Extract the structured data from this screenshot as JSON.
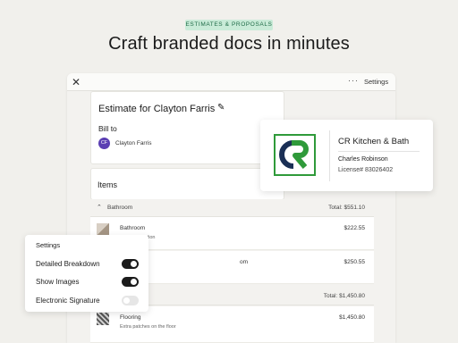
{
  "badge": "ESTIMATES & PROPOSALS",
  "headline": "Craft branded docs in minutes",
  "appbar": {
    "close_icon": "close-icon",
    "more_icon": "more-dots-icon",
    "settings_label": "Settings"
  },
  "estimate": {
    "title": "Estimate for Clayton Farris",
    "edit_icon": "pencil-icon",
    "bill_to_label": "Bill to",
    "client_initials": "CF",
    "client_name": "Clayton Farris"
  },
  "items": {
    "label": "Items",
    "groups": [
      {
        "name": "Bathroom",
        "total": "Total: $551.10"
      },
      {
        "name": "",
        "total": "Total: $1,450.80"
      }
    ],
    "line_items": [
      {
        "name": "Bathroom",
        "description": "binet installation",
        "price": "$222.55"
      },
      {
        "name": "om",
        "description": "",
        "price": "$250.55"
      },
      {
        "name": "Flooring",
        "description": "Extra patches on the floor",
        "price": "$1,450.80"
      }
    ]
  },
  "company": {
    "logo_letters": "CR",
    "name": "CR Kitchen & Bath",
    "person": "Charles Robinson",
    "license": "License# 83026402",
    "brand_green": "#2f9a3a",
    "brand_navy": "#1a2f55"
  },
  "settings": {
    "title": "Settings",
    "toggles": [
      {
        "label": "Detailed Breakdown",
        "on": true
      },
      {
        "label": "Show Images",
        "on": true
      },
      {
        "label": "Electronic Signature",
        "on": false
      }
    ]
  }
}
